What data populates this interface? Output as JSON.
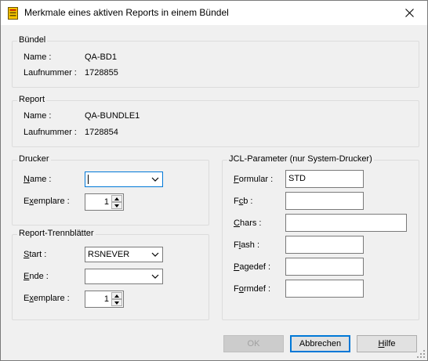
{
  "window": {
    "title": "Merkmale eines aktiven Reports in einem Bündel"
  },
  "buendel": {
    "group_label": "Bündel",
    "name_label": "Name :",
    "name_value": "QA-BD1",
    "laufnummer_label": "Laufnummer :",
    "laufnummer_value": "1728855"
  },
  "report": {
    "group_label": "Report",
    "name_label": "Name :",
    "name_value": "QA-BUNDLE1",
    "laufnummer_label": "Laufnummer :",
    "laufnummer_value": "1728854"
  },
  "drucker": {
    "group_label": "Drucker",
    "name_label_pre": "",
    "name_label_ul": "N",
    "name_label_post": "ame :",
    "name_value": "",
    "exemplare_label_pre": "E",
    "exemplare_label_ul": "x",
    "exemplare_label_post": "emplare :",
    "exemplare_value": "1"
  },
  "trennblaetter": {
    "group_label": "Report-Trennblätter",
    "start_label_ul": "S",
    "start_label_post": "tart :",
    "start_value": "RSNEVER",
    "ende_label_ul": "E",
    "ende_label_post": "nde :",
    "ende_value": "",
    "exemplare_label_pre": "E",
    "exemplare_label_ul": "x",
    "exemplare_label_post": "emplare :",
    "exemplare_value": "1"
  },
  "jcl": {
    "group_label": "JCL-Parameter (nur System-Drucker)",
    "formular_label_ul": "F",
    "formular_label_post": "ormular :",
    "formular_value": "STD",
    "fcb_label_pre": "F",
    "fcb_label_ul": "c",
    "fcb_label_post": "b :",
    "fcb_value": "",
    "chars_label_ul": "C",
    "chars_label_post": "hars :",
    "chars_value": "",
    "flash_label_pre": "F",
    "flash_label_ul": "l",
    "flash_label_post": "ash :",
    "flash_value": "",
    "pagedef_label_ul": "P",
    "pagedef_label_post": "agedef :",
    "pagedef_value": "",
    "formdef_label_pre": "F",
    "formdef_label_ul": "o",
    "formdef_label_post": "rmdef :",
    "formdef_value": ""
  },
  "buttons": {
    "ok": "OK",
    "abbrechen": "Abbrechen",
    "hilfe_ul": "H",
    "hilfe_post": "ilfe"
  },
  "icons": {
    "title": "report-bundle-icon",
    "close": "close-icon",
    "dropdown": "chevron-down-icon",
    "spin_up": "spin-up-icon",
    "spin_down": "spin-down-icon",
    "grip": "resize-grip-icon"
  },
  "colors": {
    "background": "#f0f0f0",
    "focus": "#0078d7",
    "icon_yellow": "#f5c400",
    "icon_red": "#c00000"
  }
}
